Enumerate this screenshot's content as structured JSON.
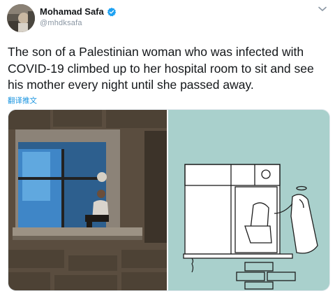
{
  "tweet": {
    "author_name": "Mohamad Safa",
    "handle": "@mhdksafa",
    "text": "The son of a Palestinian woman who was infected with COVID-19 climbed up to her hospital room to sit and see his mother every night until she passed away.",
    "translate_label": "翻译推文"
  },
  "icons": {
    "verified": "verified-badge-icon",
    "more": "chevron-down-icon"
  },
  "colors": {
    "link": "#1b95e0",
    "verified": "#1da1f2",
    "cartoon_background": "#a9d0cc"
  },
  "media": {
    "count": 2
  }
}
